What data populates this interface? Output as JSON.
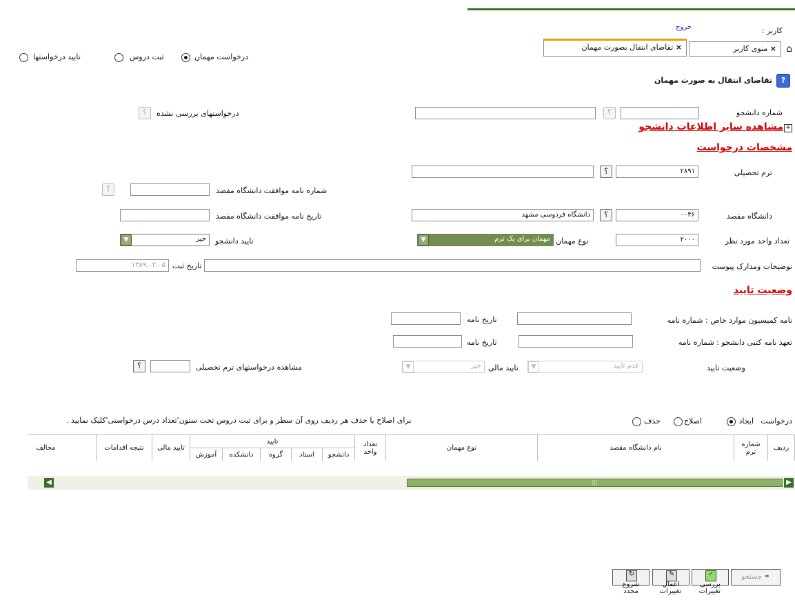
{
  "header": {
    "user_label": "کاربر :",
    "logout_label": "خروج",
    "tabs": [
      {
        "label": "منوی کاربر"
      },
      {
        "label": "تقاضای انتقال بصورت مهمان"
      }
    ],
    "close_symbol": "×",
    "home_symbol": "⌂"
  },
  "mode_radios": {
    "options": [
      {
        "label": "درخواست مهمان",
        "checked": true
      },
      {
        "label": "ثبت دروس",
        "checked": false
      },
      {
        "label": "تایید درخواستها",
        "checked": false
      }
    ]
  },
  "page": {
    "title": "تقاضای انتقال به صورت مهمان",
    "student_no_label": "شماره دانشجو",
    "student_no_value": "",
    "reviewed_requests_label": "درخواستهای بررسی نشده",
    "more_info_link": "مشاهده سایر اطلاعات دانشجو",
    "expand_symbol": "+"
  },
  "request_section": {
    "title": "مشخصات درخواست",
    "term_label": "ترم تحصیلی",
    "term_value": "۲۸۹۱",
    "dest_univ_label": "دانشگاه مقصد",
    "dest_univ_code": "۰۰۳۶",
    "dest_univ_name": "دانشگاه فردوسی مشهد",
    "units_label": "تعداد واحد مورد نظر",
    "units_value": "۲۰۰۰",
    "guest_type_label": "نوع مهمان",
    "guest_type_value": "مهمان برای یک ترم",
    "agree_letter_no_label": "شماره نامه موافقت دانشگاه مقصد",
    "agree_letter_date_label": "تاریخ نامه موافقت دانشگاه مقصد",
    "student_confirm_label": "تایید دانشجو",
    "student_confirm_value": "خیر",
    "attachments_label": "توضیحات ومدارک پیوست",
    "reg_date_label": "تاریخ ثبت",
    "reg_date_value": "۱۳۸۹.۰۲.۰۵",
    "help_symbol": "؟"
  },
  "approval_section": {
    "title": "وضعیت تایید",
    "commission_label": "نامه کمیسیون موارد خاص : شماره نامه",
    "letter_date_label": "تاریخ نامه",
    "pledge_label": "تعهد نامه کتبی دانشجو : شماره نامه",
    "pledge_date_label": "تاریخ نامه",
    "status_label": "وضعیت تایید",
    "status_value": "عدم تایید",
    "financial_label": "تایید مالی",
    "financial_value": "خیر",
    "view_term_requests_label": "مشاهده درخواستهای ترم تحصیلی"
  },
  "grid_controls": {
    "request_label": "درخواست",
    "options": [
      {
        "label": "ایجاد",
        "checked": true
      },
      {
        "label": "اصلاح",
        "checked": false
      },
      {
        "label": "حذف",
        "checked": false
      }
    ],
    "hint": "برای اصلاح یا حذف هر ردیف روی آن سطر و برای ثبت دروس تحت ستون'تعداد درس درخواستی'کلیک نمایید ."
  },
  "grid": {
    "col_row": "ردیف",
    "col_term": "شماره ترم",
    "col_univ": "نام دانشگاه مقصد",
    "col_guest_type": "نوع مهمان",
    "col_units": "تعداد واحد",
    "col_approval": "تایید",
    "sub_student": "دانشجو",
    "sub_professor": "استاد",
    "sub_group": "گروه",
    "sub_faculty": "دانشکده",
    "sub_education": "آموزش",
    "col_financial": "تایید مالی",
    "col_result": "نتیجه اقدامات",
    "col_opposition": "مخالف"
  },
  "toolbar": {
    "search_label": "جستجو",
    "review_label": "بررسی تغییرات",
    "apply_label": "اعمال تغییرات",
    "restart_label": "شروع مجدد"
  },
  "colors": {
    "accent_green": "#8fb06a",
    "section_red": "#d40000",
    "tab_orange": "#f0a000",
    "top_line_green": "#2d7a1f"
  }
}
